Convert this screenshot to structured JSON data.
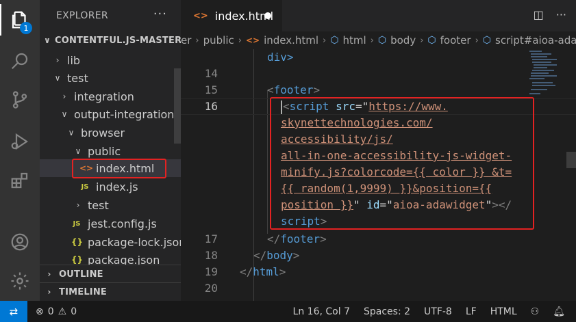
{
  "activity_bar": {
    "icons": [
      "files-icon",
      "search-icon",
      "source-control-icon",
      "run-debug-icon",
      "extensions-icon",
      "account-icon",
      "settings-gear-icon"
    ],
    "badge": "1"
  },
  "explorer": {
    "title": "EXPLORER",
    "more": "···",
    "root": "CONTENTFUL.JS-MASTER",
    "items": [
      {
        "label": "lib",
        "type": "folder-closed"
      },
      {
        "label": "test",
        "type": "folder-open"
      },
      {
        "label": "integration",
        "type": "folder-closed"
      },
      {
        "label": "output-integration",
        "type": "folder-open"
      },
      {
        "label": "browser",
        "type": "folder-open"
      },
      {
        "label": "public",
        "type": "folder-open"
      },
      {
        "label": "index.html",
        "type": "html"
      },
      {
        "label": "index.js",
        "type": "js"
      },
      {
        "label": "test",
        "type": "folder-closed"
      },
      {
        "label": "jest.config.js",
        "type": "js"
      },
      {
        "label": "package-lock.json",
        "type": "json"
      },
      {
        "label": "package.json",
        "type": "json"
      }
    ],
    "outline": "OUTLINE",
    "timeline": "TIMELINE"
  },
  "tab": {
    "label": "index.html",
    "icon": "<>"
  },
  "breadcrumb": [
    "er",
    "public",
    "index.html",
    "html",
    "body",
    "footer",
    "script#aioa-ada"
  ],
  "editor": {
    "line_numbers": [
      "14",
      "15",
      "16",
      "17",
      "18",
      "19",
      "20"
    ],
    "lines": {
      "l_div": "div>",
      "l15_open": "<",
      "l15_tag": "footer",
      "l15_close": ">",
      "l16_open": "<",
      "l16_tag": "script",
      "l16_attr": "src",
      "l16_eq": "=\"",
      "l16_url1": "https://www.",
      "w1": "skynettechnologies.com/",
      "w2": "accessibility/js/",
      "w3": "all-in-one-accessibility-js-widget-",
      "w4": "minify.js?colorcode={{ color }} &t=",
      "w5": "{{ random(1,9999) }}&position={{",
      "w6a": "position }}",
      "w6b": "\" ",
      "w6c": "id",
      "w6d": "=\"",
      "w6e": "aioa-adawidget",
      "w6f": "\"",
      "w6g": "></",
      "w7": "script",
      "w7b": ">",
      "l17_open": "</",
      "l17_tag": "footer",
      "l17_close": ">",
      "l18_open": "</",
      "l18_tag": "body",
      "l18_close": ">",
      "l19_open": "</",
      "l19_tag": "html",
      "l19_close": ">"
    }
  },
  "statusbar": {
    "errors": "0",
    "warnings": "0",
    "position": "Ln 16, Col 7",
    "spaces": "Spaces: 2",
    "encoding": "UTF-8",
    "eol": "LF",
    "language": "HTML"
  },
  "colors": {
    "accent": "#0078d4",
    "highlight_red": "#e32222",
    "tag_blue": "#569cd6",
    "string_orange": "#ce9178",
    "attr_lightblue": "#9cdcfe"
  }
}
